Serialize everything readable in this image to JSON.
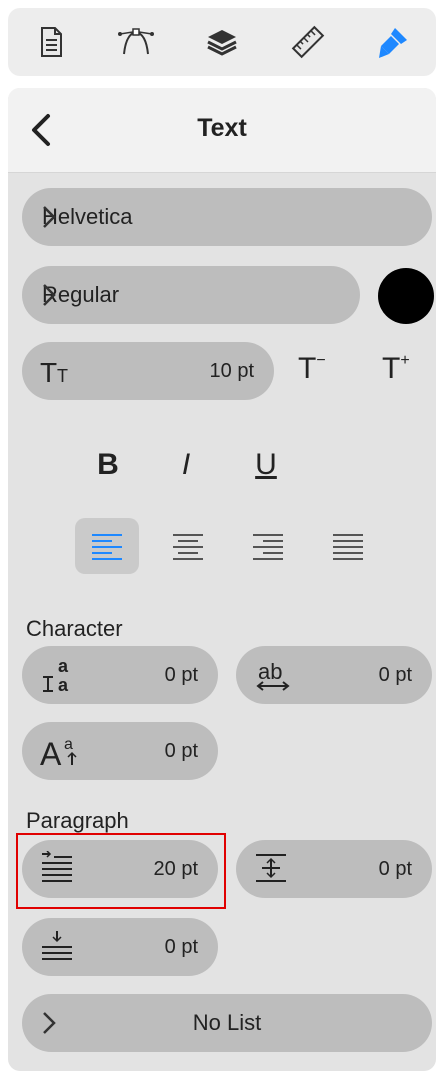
{
  "toolbar": {
    "icons": [
      "document-icon",
      "pen-tool-icon",
      "layers-icon",
      "ruler-icon",
      "paintbrush-icon"
    ],
    "active_color": "#1e88ff"
  },
  "panel": {
    "title": "Text"
  },
  "font": {
    "family": "Helvetica",
    "style": "Regular",
    "color": "#000000",
    "size_value": "10 pt",
    "decrease_label": "T",
    "decrease_suffix": "−",
    "increase_label": "T",
    "increase_suffix": "+"
  },
  "text_style": {
    "bold": "B",
    "italic": "I",
    "underline": "U"
  },
  "alignment": {
    "selected": "left",
    "accent": "#1e88ff"
  },
  "character": {
    "label": "Character",
    "line_spacing_value": "0 pt",
    "char_spacing_value": "0 pt",
    "baseline_value": "0 pt"
  },
  "paragraph": {
    "label": "Paragraph",
    "indent_value": "20 pt",
    "space_before_value": "0 pt",
    "space_after_value": "0 pt",
    "list_value": "No List"
  }
}
